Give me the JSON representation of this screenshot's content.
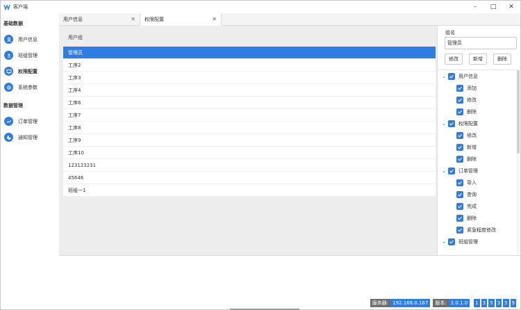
{
  "app": {
    "title": "客户端"
  },
  "sidebar": {
    "sections": [
      {
        "title": "基础数据",
        "items": [
          {
            "label": "用户信息",
            "icon": "user-icon"
          },
          {
            "label": "班组管理",
            "icon": "team-icon"
          },
          {
            "label": "权限配置",
            "icon": "monitor-icon",
            "active": true
          },
          {
            "label": "系统参数",
            "icon": "settings-icon"
          }
        ]
      },
      {
        "title": "数据管理",
        "items": [
          {
            "label": "订单管理",
            "icon": "trend-icon"
          },
          {
            "label": "通知管理",
            "icon": "clock-icon"
          }
        ]
      }
    ]
  },
  "tabs": [
    {
      "label": "用户信息"
    },
    {
      "label": "权限配置",
      "active": true
    }
  ],
  "grid": {
    "header": "用户组",
    "rows": [
      "管理员",
      "工序2",
      "工序3",
      "工序4",
      "工序6",
      "工序7",
      "工序8",
      "工序9",
      "工序10",
      "123123231",
      "45646",
      "班组一1"
    ],
    "selected_index": 0
  },
  "panel": {
    "group_label": "组名",
    "group_value": "管理员",
    "buttons": {
      "edit": "修改",
      "add": "新增",
      "delete": "删除"
    },
    "tree": [
      {
        "label": "用户信息",
        "level": 0,
        "checked": true,
        "expanded": true
      },
      {
        "label": "添加",
        "level": 1,
        "checked": true
      },
      {
        "label": "修改",
        "level": 1,
        "checked": true
      },
      {
        "label": "删除",
        "level": 1,
        "checked": true
      },
      {
        "label": "权限配置",
        "level": 0,
        "checked": true,
        "expanded": true
      },
      {
        "label": "修改",
        "level": 1,
        "checked": true
      },
      {
        "label": "新增",
        "level": 1,
        "checked": true
      },
      {
        "label": "删除",
        "level": 1,
        "checked": true
      },
      {
        "label": "订单管理",
        "level": 0,
        "checked": true,
        "expanded": true
      },
      {
        "label": "导入",
        "level": 1,
        "checked": true
      },
      {
        "label": "查询",
        "level": 1,
        "checked": true
      },
      {
        "label": "完成",
        "level": 1,
        "checked": true
      },
      {
        "label": "删除",
        "level": 1,
        "checked": true
      },
      {
        "label": "紧急程度修改",
        "level": 1,
        "checked": true
      },
      {
        "label": "班组管理",
        "level": 0,
        "checked": true,
        "expanded": true
      }
    ]
  },
  "status": {
    "server_label": "服务器:",
    "server_value": "192.168.0.167",
    "version_label": "版本:",
    "version_value": "1.0.1.0",
    "badges": [
      "1",
      "3",
      "5",
      "3",
      "5",
      "9"
    ]
  },
  "colors": {
    "accent": "#2f7de1"
  }
}
